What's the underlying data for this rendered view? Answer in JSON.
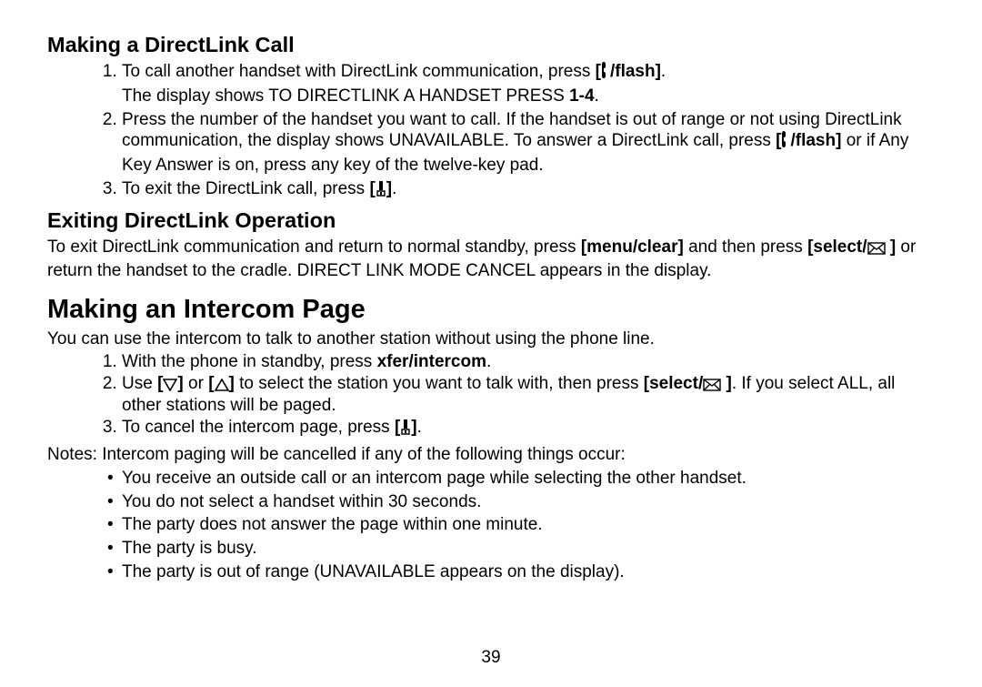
{
  "section1": {
    "heading": "Making a DirectLink Call",
    "items": [
      {
        "pre": "To call another handset with DirectLink communication, press ",
        "key_pre": "[",
        "icon": "talk",
        "key_post": "/flash]",
        "post": ".",
        "line2a": "The display shows TO DIRECTLINK A HANDSET PRESS ",
        "line2b": "1-4",
        "line2c": "."
      },
      {
        "pre": "Press the number of the handset you want to call. If the handset is out of range or not using DirectLink communication, the display shows UNAVAILABLE. To answer a DirectLink call, press ",
        "key_pre": "[",
        "icon": "talk",
        "key_post": "/flash]",
        "post": " or if Any Key Answer is on, press any key of the twelve-key pad."
      },
      {
        "pre": "To exit the DirectLink call, press ",
        "key_pre": "[",
        "icon": "end",
        "key_post": "]",
        "post": "."
      }
    ]
  },
  "section2": {
    "heading": "Exiting DirectLink Operation",
    "para_a": "To exit DirectLink communication and return to normal standby, press ",
    "key1": "[menu/clear]",
    "mid": " and then press ",
    "key2_pre": "[select/",
    "key2_icon": "envelope",
    "key2_post": " ]",
    "para_b": " or return the handset to the cradle. DIRECT LINK MODE CANCEL appears in the display."
  },
  "section3": {
    "heading": "Making an Intercom Page",
    "intro": "You can use the intercom to talk to another station without using the phone line.",
    "items": [
      {
        "pre": "With the phone in standby, press ",
        "key": "xfer/intercom",
        "post": "."
      },
      {
        "pre": "Use ",
        "k1_pre": "[",
        "k1_icon": "down",
        "k1_post": "]",
        "mid1": " or ",
        "k2_pre": "[",
        "k2_icon": "up",
        "k2_post": "]",
        "mid2": " to select the station you want to talk with, then press ",
        "k3_pre": "[select/",
        "k3_icon": "envelope",
        "k3_post": " ]",
        "post": ". If you select ALL, all other stations will be paged."
      },
      {
        "pre": "To cancel the intercom page, press ",
        "k_pre": "[",
        "k_icon": "end",
        "k_post": "]",
        "post": "."
      }
    ],
    "notes_lead": "Notes: Intercom paging will be cancelled if any of the following things occur:",
    "notes": [
      "You receive an outside call or an intercom page while selecting the other handset.",
      "You do not select a handset within 30 seconds.",
      "The party does not answer the page within one minute.",
      "The party is busy.",
      "The party is out of range (UNAVAILABLE appears on the display)."
    ]
  },
  "page_number": "39",
  "icons": {
    "talk": "talk-icon",
    "end": "end-icon",
    "envelope": "envelope-icon",
    "down": "down-triangle-icon",
    "up": "up-triangle-icon"
  }
}
